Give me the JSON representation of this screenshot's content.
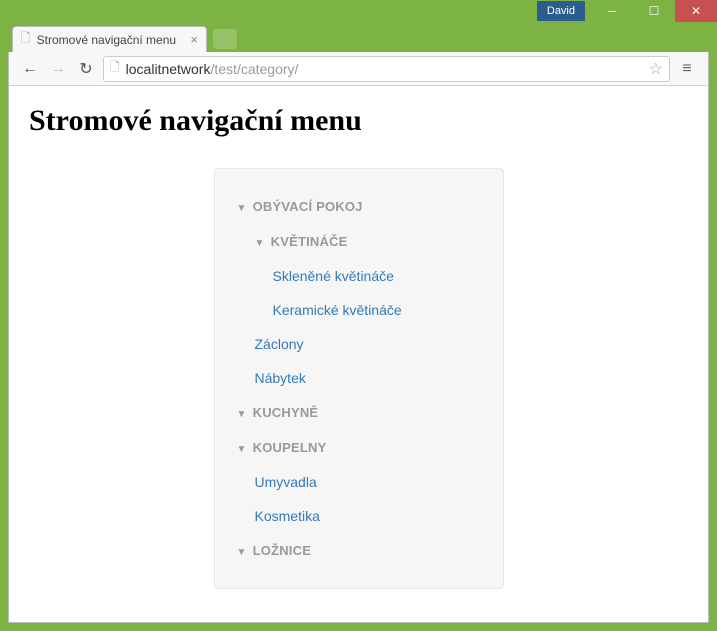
{
  "window": {
    "user_badge": "David"
  },
  "tab": {
    "title": "Stromové navigační menu"
  },
  "omnibox": {
    "host": "localitnetwork",
    "path": "/test/category/"
  },
  "page": {
    "heading": "Stromové navigační menu"
  },
  "tree": [
    {
      "type": "category",
      "level": 1,
      "label": "OBÝVACÍ POKOJ"
    },
    {
      "type": "category",
      "level": 2,
      "label": "KVĚTINÁČE"
    },
    {
      "type": "link",
      "level": 3,
      "label": "Skleněné květináče"
    },
    {
      "type": "link",
      "level": 3,
      "label": "Keramické květináče"
    },
    {
      "type": "link",
      "level": 2,
      "label": "Záclony"
    },
    {
      "type": "link",
      "level": 2,
      "label": "Nábytek"
    },
    {
      "type": "category",
      "level": 1,
      "label": "KUCHYNĚ"
    },
    {
      "type": "category",
      "level": 1,
      "label": "KOUPELNY"
    },
    {
      "type": "link",
      "level": 2,
      "label": "Umyvadla"
    },
    {
      "type": "link",
      "level": 2,
      "label": "Kosmetika"
    },
    {
      "type": "category",
      "level": 1,
      "label": "LOŽNICE"
    }
  ]
}
